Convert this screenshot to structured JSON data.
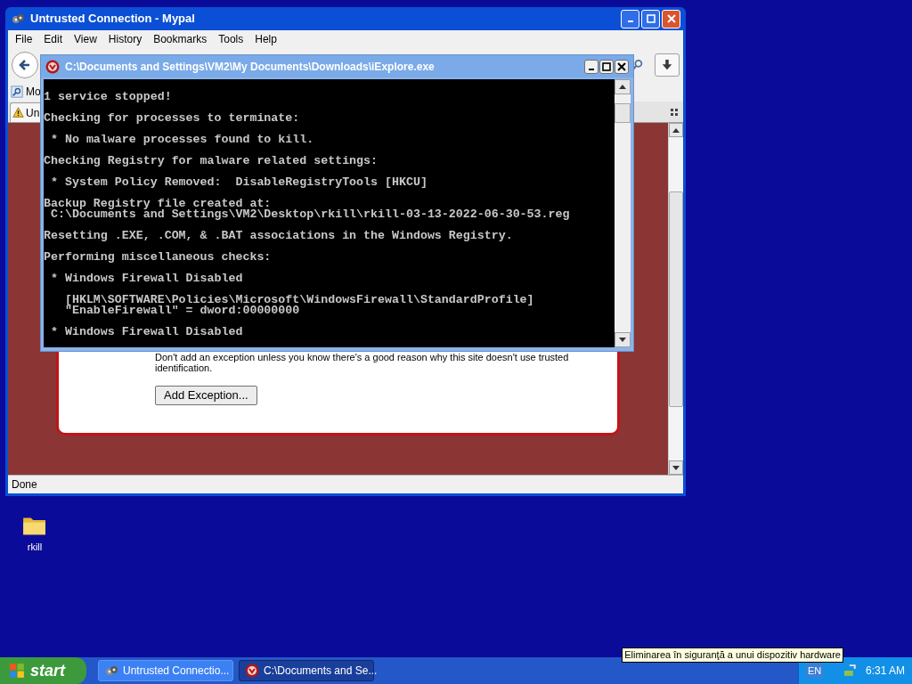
{
  "browser": {
    "title": "Untrusted Connection - Mypal",
    "menu": [
      "File",
      "Edit",
      "View",
      "History",
      "Bookmarks",
      "Tools",
      "Help"
    ],
    "bookmark": "Mo",
    "tab": "Un",
    "page": {
      "warning": "Don't add an exception unless you know there's a good reason why this site doesn't use trusted identification.",
      "button": "Add Exception..."
    },
    "status": "Done"
  },
  "console": {
    "title": "C:\\Documents and Settings\\VM2\\My Documents\\Downloads\\iExplore.exe",
    "blocks": [
      [
        "1 service stopped!"
      ],
      [
        "Checking for processes to terminate:"
      ],
      [
        " * No malware processes found to kill."
      ],
      [
        "Checking Registry for malware related settings:"
      ],
      [
        " * System Policy Removed:  DisableRegistryTools [HKCU]"
      ],
      [
        "Backup Registry file created at:",
        " C:\\Documents and Settings\\VM2\\Desktop\\rkill\\rkill-03-13-2022-06-30-53.reg"
      ],
      [
        "Resetting .EXE, .COM, & .BAT associations in the Windows Registry."
      ],
      [
        "Performing miscellaneous checks:"
      ],
      [
        " * Windows Firewall Disabled"
      ],
      [
        "   [HKLM\\SOFTWARE\\Policies\\Microsoft\\WindowsFirewall\\StandardProfile]",
        "   \"EnableFirewall\" = dword:00000000"
      ],
      [
        " * Windows Firewall Disabled"
      ]
    ]
  },
  "desktop_icons": [
    {
      "label": "rkill"
    }
  ],
  "taskbar": {
    "start": "start",
    "tasks": [
      {
        "label": "Untrusted Connectio...",
        "kind": "browser",
        "selected": false
      },
      {
        "label": "C:\\Documents and Se...",
        "kind": "console",
        "selected": true
      }
    ],
    "language": "EN",
    "clock": "6:31 AM",
    "tooltip": "Eliminarea în siguranţă a unui dispozitiv hardware"
  }
}
